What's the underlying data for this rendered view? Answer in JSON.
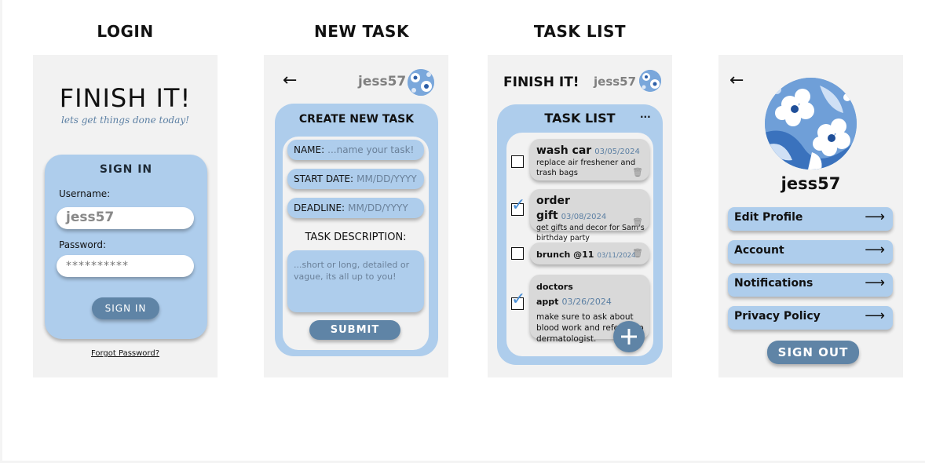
{
  "screens": {
    "login": "LOGIN",
    "new_task": "NEW TASK",
    "task_list": "TASK LIST"
  },
  "login": {
    "app_title": "FINISH IT!",
    "tagline": "lets get things done today!",
    "signin_header": "SIGN IN",
    "username_label": "Username:",
    "username_value": "jess57",
    "password_label": "Password:",
    "password_value": "**********",
    "signin_button": "SIGN IN",
    "forgot_link": "Forgot Password?"
  },
  "new_task": {
    "username": "jess57",
    "header": "CREATE NEW TASK",
    "name_label": "NAME:",
    "name_placeholder": "...name your task!",
    "start_label": "START DATE:",
    "start_placeholder": "MM/DD/YYYY",
    "deadline_label": "DEADLINE:",
    "deadline_placeholder": "MM/DD/YYYY",
    "desc_label": "TASK DESCRIPTION:",
    "desc_placeholder": "...short or long, detailed or vague, its all up to you!",
    "submit": "SUBMIT"
  },
  "task_list": {
    "app_title": "FINISH IT!",
    "username": "jess57",
    "header": "TASK LIST",
    "more": "...",
    "tasks": [
      {
        "name": "wash car",
        "date": "03/05/2024",
        "desc": "replace air freshener and trash bags",
        "checked": false
      },
      {
        "name": "order gift",
        "date": "03/08/2024",
        "desc": "get gifts and decor for Sam's birthday party",
        "checked": true
      },
      {
        "name": "brunch @11",
        "date": "03/11/2024",
        "desc": "",
        "checked": false
      },
      {
        "name": "doctors appt",
        "date": "03/26/2024",
        "desc": "make sure to ask about blood work and referral to dermatologist.",
        "checked": true
      }
    ],
    "add_icon": "plus-icon"
  },
  "profile": {
    "username": "jess57",
    "menu": [
      {
        "label": "Edit Profile"
      },
      {
        "label": "Account"
      },
      {
        "label": "Notifications"
      },
      {
        "label": "Privacy Policy"
      }
    ],
    "signout": "SIGN OUT"
  },
  "colors": {
    "card_blue": "#aecdec",
    "button_dark": "#5f84a6",
    "accent_text": "#5b7fa3",
    "panel": "#f2f2f2"
  }
}
